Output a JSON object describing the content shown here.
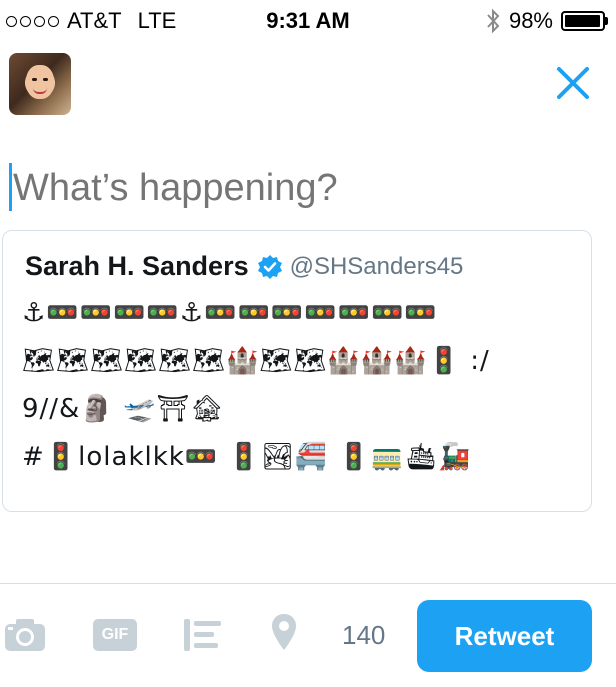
{
  "status_bar": {
    "carrier": "AT&T",
    "network": "LTE",
    "time": "9:31 AM",
    "battery": "98%",
    "battery_level": 0.98,
    "icons": [
      "signal-dots-icon",
      "bluetooth-icon",
      "battery-icon"
    ]
  },
  "header": {
    "avatar": "avatar",
    "close_icon": "close-icon"
  },
  "compose": {
    "placeholder": "What’s happening?"
  },
  "quoted_tweet": {
    "name": "Sarah H. Sanders",
    "verified_icon": "verified-badge-icon",
    "handle": "@SHSanders45",
    "lines": [
      "⚓🚥🚥🚥🚥⚓🚥🚥🚥🚥🚥🚥🚥",
      "🗺🗺🗺🗺🗺🗺🏰🗺🗺🏰🏰🏰🚦 :/",
      "9//&🗿 🛫⛩🏚",
      " #🚦lolaklkk🚥 🚦🏞🚝 🚦🚃🛳🚂"
    ]
  },
  "toolbar": {
    "camera_icon": "camera-icon",
    "gif_label": "GIF",
    "poll_icon": "poll-icon",
    "location_icon": "location-pin-icon",
    "char_count": "140",
    "retweet_label": "Retweet"
  },
  "colors": {
    "accent": "#1da1f2",
    "secondary_text": "#657786",
    "placeholder": "#8899a6",
    "icon_gray": "#c7d1d8"
  }
}
